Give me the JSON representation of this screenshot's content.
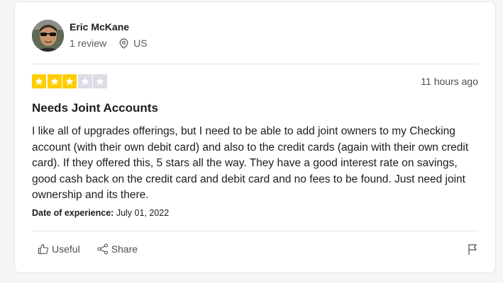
{
  "review": {
    "author": {
      "name": "Eric McKane",
      "review_count": "1 review",
      "location": "US"
    },
    "rating": {
      "value": 3,
      "max": 5,
      "filled_color": "#ffce00",
      "empty_color": "#dcdce6"
    },
    "time_ago": "11 hours ago",
    "title": "Needs Joint Accounts",
    "body": "I like all of upgrades offerings, but I need to be able to add joint owners to my Checking account (with their own debit card) and also to the credit cards (again with their own credit card). If they offered this, 5 stars all the way. They have a good interest rate on savings, good cash back on the credit card and debit card and no fees to be found. Just need joint ownership and its there.",
    "experience": {
      "label": "Date of experience:",
      "date": "July 01, 2022"
    }
  },
  "actions": {
    "useful_label": "Useful",
    "share_label": "Share"
  },
  "icons": {
    "location": "location-pin-icon",
    "useful": "thumbs-up-icon",
    "share": "share-icon",
    "report": "flag-icon",
    "star": "star-icon"
  }
}
